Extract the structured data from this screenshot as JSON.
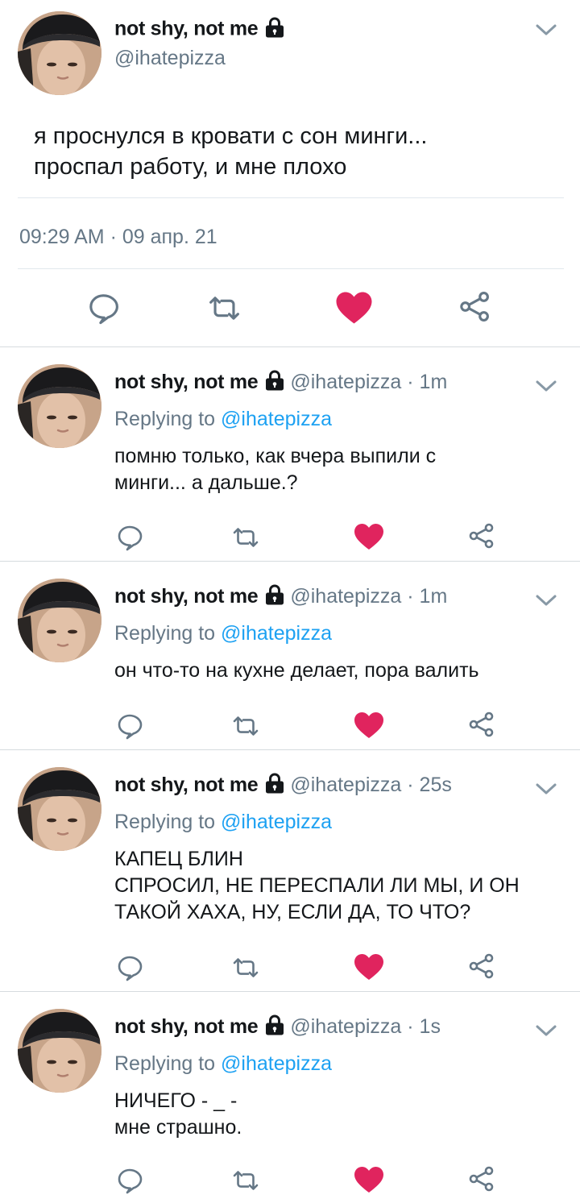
{
  "user": {
    "display_name": "not shy, not me",
    "handle": "@ihatepizza"
  },
  "main_tweet": {
    "text": "я проснулся в кровати с сон минги...\nпроспал работу, и мне плохо",
    "timestamp": "09:29 AM · 09 апр. 21"
  },
  "replies": [
    {
      "age": "1m",
      "replying_prefix": "Replying to",
      "replying_to": "@ihatepizza",
      "text": "помню только, как вчера выпили с\nминги... а дальше.?"
    },
    {
      "age": "1m",
      "replying_prefix": "Replying to",
      "replying_to": "@ihatepizza",
      "text": "он что-то на кухне делает, пора валить"
    },
    {
      "age": "25s",
      "replying_prefix": "Replying to",
      "replying_to": "@ihatepizza",
      "text": "КАПЕЦ БЛИН\nСПРОСИЛ, НЕ ПЕРЕСПАЛИ ЛИ МЫ, И ОН\nТАКОЙ ХАХА, НУ, ЕСЛИ ДА, ТО ЧТО?"
    },
    {
      "age": "1s",
      "replying_prefix": "Replying to",
      "replying_to": "@ihatepizza",
      "text": "НИЧЕГО - _ -\nмне страшно."
    }
  ],
  "icons": {
    "reply": "speech-bubble-icon",
    "retweet": "retweet-icon",
    "like": "heart-icon",
    "share": "share-icon",
    "lock": "lock-icon",
    "menu": "chevron-down-icon"
  },
  "colors": {
    "like_active": "#e0245e",
    "link": "#1da1f2",
    "secondary_text": "#657786",
    "icon_gray": "#657786"
  }
}
